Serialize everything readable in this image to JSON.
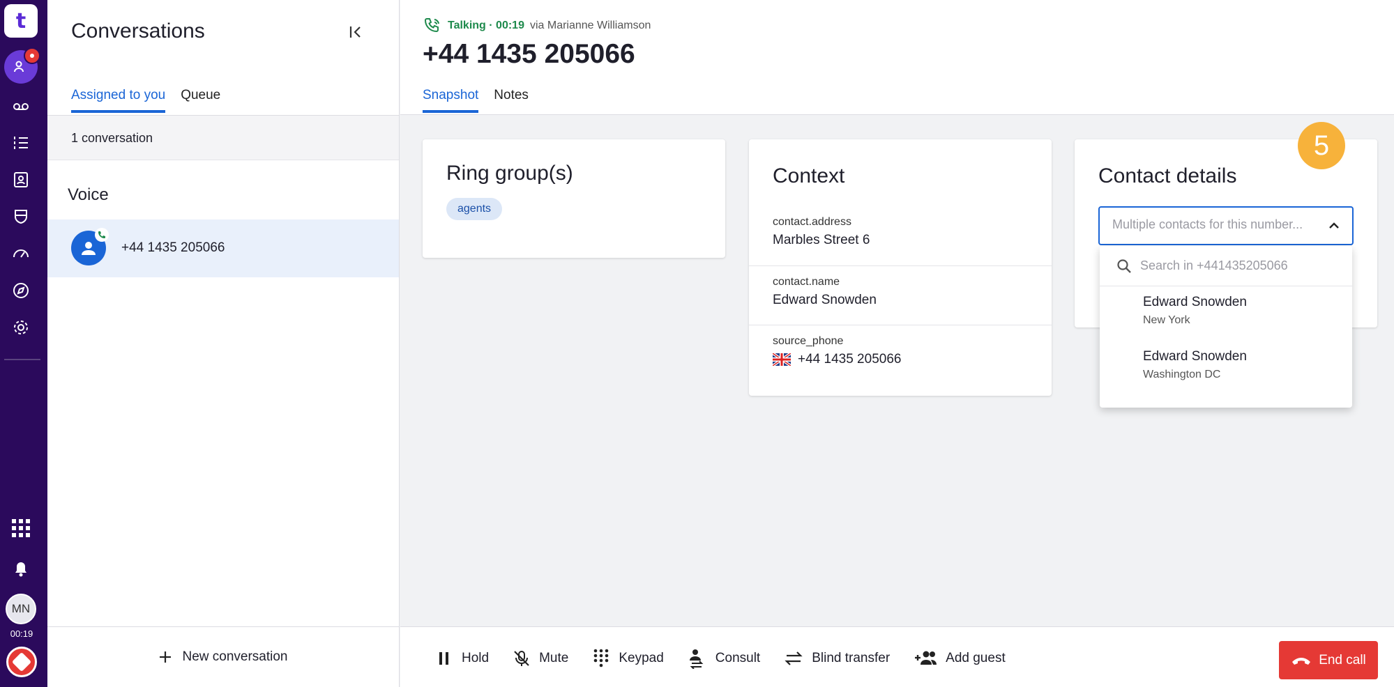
{
  "rail": {
    "logo_text": "t",
    "items": [
      "agents-icon",
      "voicemail-icon",
      "tasks-icon",
      "contacts-icon",
      "shield-icon",
      "dashboard-icon",
      "compass-icon",
      "settings-icon"
    ],
    "avatar_initials": "MN",
    "call_timer": "00:19",
    "colors": {
      "background": "#2b0a5c",
      "active": "#6a3bd8",
      "badge": "#e53935"
    }
  },
  "conversations": {
    "title": "Conversations",
    "tabs": [
      {
        "label": "Assigned to you",
        "active": true
      },
      {
        "label": "Queue",
        "active": false
      }
    ],
    "count_text": "1 conversation",
    "section": "Voice",
    "items": [
      {
        "number": "+44 1435 205066"
      }
    ],
    "new_button": "New conversation"
  },
  "header": {
    "status_talking": "Talking · 00:19",
    "status_via": "via Marianne Williamson",
    "title": "+44 1435 205066",
    "tabs": [
      {
        "label": "Snapshot",
        "active": true
      },
      {
        "label": "Notes",
        "active": false
      }
    ]
  },
  "ring_group": {
    "title": "Ring group(s)",
    "chip": "agents"
  },
  "context": {
    "title": "Context",
    "fields": [
      {
        "key": "contact.address",
        "value": "Marbles Street 6"
      },
      {
        "key": "contact.name",
        "value": "Edward Snowden"
      },
      {
        "key": "source_phone",
        "value": "+44 1435 205066"
      }
    ]
  },
  "contact_details": {
    "title": "Contact details",
    "select_placeholder": "Multiple contacts for this number...",
    "step_badge": "5",
    "search_placeholder": "Search in +441435205066",
    "options": [
      {
        "name": "Edward Snowden",
        "city": "New York"
      },
      {
        "name": "Edward Snowden",
        "city": "Washington DC"
      }
    ]
  },
  "bottom": {
    "actions": [
      {
        "label": "Hold",
        "icon": "pause-icon"
      },
      {
        "label": "Mute",
        "icon": "mic-off-icon"
      },
      {
        "label": "Keypad",
        "icon": "keypad-icon"
      },
      {
        "label": "Consult",
        "icon": "consult-icon"
      },
      {
        "label": "Blind transfer",
        "icon": "transfer-icon"
      },
      {
        "label": "Add guest",
        "icon": "add-guest-icon"
      }
    ],
    "end_call": "End call",
    "colors": {
      "end_call": "#e53935",
      "accent": "#1a65d6"
    }
  }
}
